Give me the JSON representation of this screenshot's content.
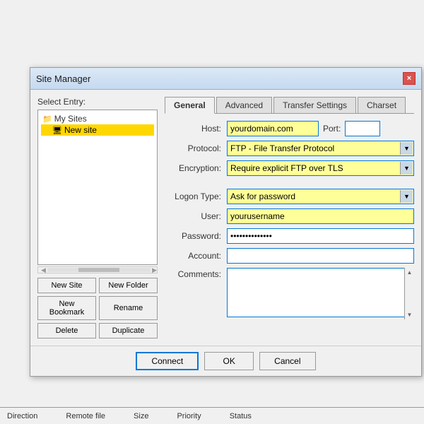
{
  "app": {
    "bottom_bar": {
      "labels": [
        "Direction",
        "Remote file",
        "Size",
        "Priority",
        "Status"
      ]
    }
  },
  "dialog": {
    "title": "Site Manager",
    "close_label": "×",
    "left_panel": {
      "label": "Select Entry:",
      "tree": {
        "root": "My Sites",
        "children": [
          "New site"
        ]
      },
      "buttons": {
        "new_site": "New Site",
        "new_folder": "New Folder",
        "new_bookmark": "New Bookmark",
        "rename": "Rename",
        "delete": "Delete",
        "duplicate": "Duplicate"
      }
    },
    "tabs": [
      "General",
      "Advanced",
      "Transfer Settings",
      "Charset"
    ],
    "active_tab": "General",
    "form": {
      "host_label": "Host:",
      "host_value": "yourdomain.com",
      "port_label": "Port:",
      "port_value": "",
      "protocol_label": "Protocol:",
      "protocol_value": "FTP - File Transfer Protocol",
      "encryption_label": "Encryption:",
      "encryption_value": "Require explicit FTP over TLS",
      "logon_type_label": "Logon Type:",
      "logon_type_value": "Ask for password",
      "user_label": "User:",
      "user_value": "yourusername",
      "password_label": "Password:",
      "password_value": "••••••••••••",
      "account_label": "Account:",
      "account_value": "",
      "comments_label": "Comments:",
      "comments_value": ""
    },
    "footer": {
      "connect": "Connect",
      "ok": "OK",
      "cancel": "Cancel"
    }
  }
}
